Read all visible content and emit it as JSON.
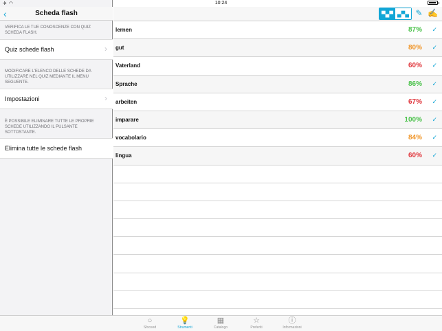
{
  "status_bar": {
    "time": "10:24"
  },
  "left": {
    "title": "Scheda flash",
    "note1": "VERIFICA LE TUE CONOSCENZE CON QUIZ SCHEDA FLASH.",
    "cell1": "Quiz schede flash",
    "note2": "MODIFICARE L'ELENCO DELLE SCHEDE DA UTILIZZARE NEL QUIZ MEDIANTE IL MENU SEGUENTE.",
    "cell2": "Impostazioni",
    "note3": "È POSSIBILE ELIMINARE TUTTE LE PROPRIE SCHEDE UTILIZZANDO IL PULSANTE SOTTOSTANTE.",
    "cell3": "Elimina tutte le schede flash"
  },
  "words": [
    {
      "word": "lernen",
      "pct": "87%",
      "color": "#4cc24c"
    },
    {
      "word": "gut",
      "pct": "80%",
      "color": "#f0962a"
    },
    {
      "word": "Vaterland",
      "pct": "60%",
      "color": "#e0383e"
    },
    {
      "word": "Sprache",
      "pct": "86%",
      "color": "#4cc24c"
    },
    {
      "word": "arbeiten",
      "pct": "67%",
      "color": "#e0383e"
    },
    {
      "word": "imparare",
      "pct": "100%",
      "color": "#4cc24c"
    },
    {
      "word": "vocabolario",
      "pct": "84%",
      "color": "#f0962a"
    },
    {
      "word": "lingua",
      "pct": "60%",
      "color": "#e0383e"
    }
  ],
  "tabs": [
    {
      "label": "Sfoceed",
      "icon": "circle-icon"
    },
    {
      "label": "Strumenti",
      "icon": "lightbulb-icon"
    },
    {
      "label": "Catalogo",
      "icon": "grid-icon"
    },
    {
      "label": "Preferiti",
      "icon": "star-icon"
    },
    {
      "label": "Informazioni",
      "icon": "info-icon"
    }
  ],
  "accent_color": "#12a6d6"
}
